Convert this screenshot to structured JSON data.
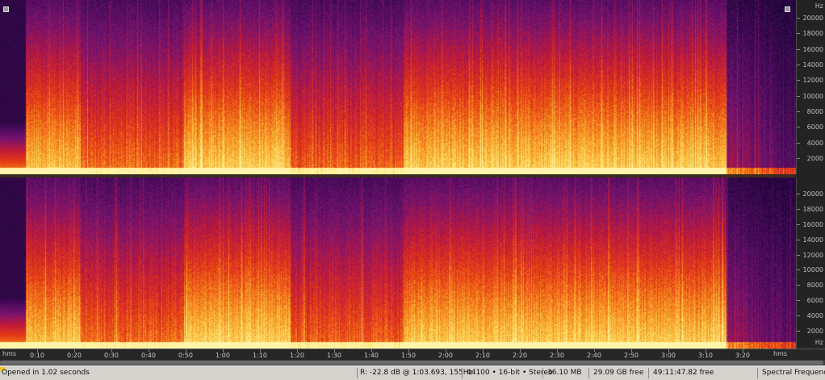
{
  "window": {
    "title": ""
  },
  "colors": {
    "spectral_low": "#1a0433",
    "spectral_mid": "#c81e1e",
    "spectral_high": "#ffe890",
    "axis_bg": "#232323",
    "status_bg": "#d6d3ce"
  },
  "frequency_axis": {
    "unit_label": "Hz",
    "ticks": [
      "20000",
      "18000",
      "16000",
      "14000",
      "12000",
      "10000",
      "8000",
      "6000",
      "4000",
      "2000"
    ],
    "bottom_unit_label": "Hz"
  },
  "time_ruler": {
    "unit_left": "hms",
    "unit_right": "hms",
    "ticks": [
      "0:10",
      "0:20",
      "0:30",
      "0:40",
      "0:50",
      "1:00",
      "1:10",
      "1:20",
      "1:30",
      "1:40",
      "1:50",
      "2:00",
      "2:10",
      "2:20",
      "2:30",
      "2:40",
      "2:50",
      "3:00",
      "3:10",
      "3:20"
    ]
  },
  "status_bar": {
    "message": "Opened in 1.02 seconds",
    "cursor_readout": "R: -22.8 dB @  1:03.693, 155Hz",
    "format": "44100 • 16-bit • Stereo",
    "file_size": "36.10 MB",
    "disk_free": "29.09 GB free",
    "time_free": "49:11:47.82 free",
    "view_mode": "Spectral Frequency"
  },
  "icons": {
    "corner_left": "view-toggle-icon",
    "corner_right": "view-toggle-icon"
  }
}
